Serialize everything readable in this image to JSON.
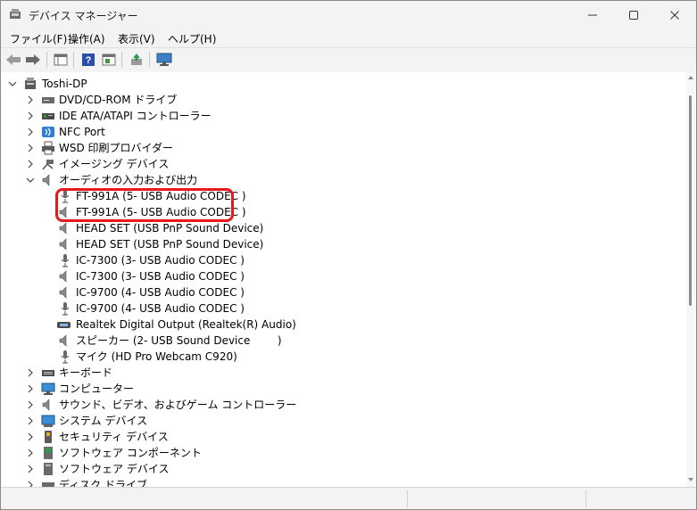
{
  "window": {
    "title": "デバイス マネージャー"
  },
  "menu": [
    {
      "label": "ファイル(F)"
    },
    {
      "label": "操作(A)"
    },
    {
      "label": "表示(V)"
    },
    {
      "label": "ヘルプ(H)"
    }
  ],
  "tree": {
    "root": "Toshi-DP",
    "categories": [
      {
        "label": "DVD/CD-ROM ドライブ",
        "icon": "dvd-drive-icon"
      },
      {
        "label": "IDE ATA/ATAPI コントローラー",
        "icon": "ide-controller-icon"
      },
      {
        "label": "NFC Port",
        "icon": "nfc-icon"
      },
      {
        "label": "WSD 印刷プロバイダー",
        "icon": "printer-icon"
      },
      {
        "label": "イメージング デバイス",
        "icon": "camera-icon"
      },
      {
        "label": "オーディオの入力および出力",
        "icon": "speaker-icon",
        "expanded": true,
        "children": [
          {
            "label": "FT-991A (5- USB Audio CODEC )",
            "icon": "microphone-icon"
          },
          {
            "label": "FT-991A (5- USB Audio CODEC )",
            "icon": "speaker-icon"
          },
          {
            "label": "HEAD SET (USB PnP Sound Device)",
            "icon": "speaker-icon"
          },
          {
            "label": "HEAD SET (USB PnP Sound Device)",
            "icon": "speaker-icon"
          },
          {
            "label": "IC-7300 (3- USB Audio CODEC )",
            "icon": "microphone-icon"
          },
          {
            "label": "IC-7300 (3- USB Audio CODEC )",
            "icon": "speaker-icon"
          },
          {
            "label": "IC-9700 (4- USB Audio CODEC )",
            "icon": "speaker-icon"
          },
          {
            "label": "IC-9700 (4- USB Audio CODEC )",
            "icon": "microphone-icon"
          },
          {
            "label": "Realtek Digital Output (Realtek(R) Audio)",
            "icon": "digital-output-icon"
          },
          {
            "label": "スピーカー (2- USB Sound Device        )",
            "icon": "speaker-icon"
          },
          {
            "label": "マイク (HD Pro Webcam C920)",
            "icon": "microphone-icon"
          }
        ]
      },
      {
        "label": "キーボード",
        "icon": "keyboard-icon"
      },
      {
        "label": "コンピューター",
        "icon": "computer-icon"
      },
      {
        "label": "サウンド、ビデオ、およびゲーム コントローラー",
        "icon": "speaker-icon"
      },
      {
        "label": "システム デバイス",
        "icon": "system-device-icon"
      },
      {
        "label": "セキュリティ デバイス",
        "icon": "security-key-icon"
      },
      {
        "label": "ソフトウェア コンポーネント",
        "icon": "software-component-icon"
      },
      {
        "label": "ソフトウェア デバイス",
        "icon": "software-device-icon"
      },
      {
        "label": "ディスク ドライブ",
        "icon": "disk-drive-icon"
      }
    ]
  },
  "annotation": {
    "color": "#e8191d"
  }
}
